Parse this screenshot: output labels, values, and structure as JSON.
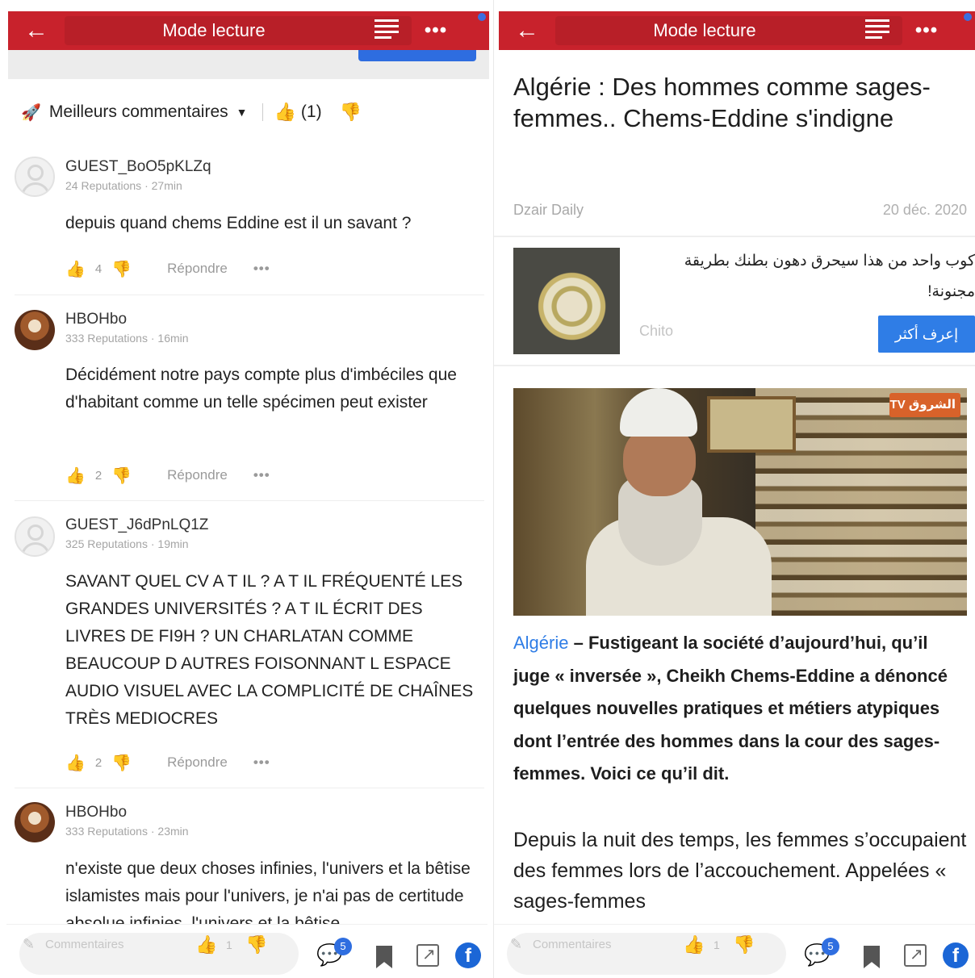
{
  "left": {
    "topbar": {
      "title": "Mode lecture",
      "back_icon": "arrow-left-icon",
      "more_label": "•••"
    },
    "sort": {
      "label": "Meilleurs commentaires",
      "like_count": "(1)"
    },
    "comments": [
      {
        "user": "GUEST_BoO5pKLZq",
        "meta": "24 Reputations · 27min",
        "text": "depuis quand chems Eddine est il un savant ?",
        "likes": "4",
        "reply": "Répondre",
        "avatar": "guest"
      },
      {
        "user": "HBOHbo",
        "meta": "333 Reputations · 16min",
        "text": "Décidément notre pays compte plus d'imbéciles que d'habitant comme un telle spécimen peut exister",
        "likes": "2",
        "reply": "Répondre",
        "avatar": "joker"
      },
      {
        "user": "GUEST_J6dPnLQ1Z",
        "meta": "325 Reputations · 19min",
        "text": "SAVANT QUEL CV A T IL ? A T IL FRÉQUENTÉ LES GRANDES UNIVERSITÉS ?  A T IL ÉCRIT DES LIVRES DE FI9H  ? UN CHARLATAN COMME BEAUCOUP D AUTRES FOISONNANT L ESPACE AUDIO VISUEL AVEC LA COMPLICITÉ DE CHAÎNES TRÈS MEDIOCRES",
        "likes": "2",
        "reply": "Répondre",
        "avatar": "guest"
      },
      {
        "user": "HBOHbo",
        "meta": "333 Reputations · 23min",
        "text": "n'existe que deux choses infinies, l'univers et la bêtise islamistes mais pour l'univers, je n'ai pas de certitude absolue infinies, l'univers et la bêtise",
        "likes": "",
        "reply": "",
        "avatar": "joker"
      }
    ],
    "bottombar": {
      "placeholder": "Commentaires",
      "like_count": "1",
      "badge": "5"
    }
  },
  "right": {
    "topbar": {
      "title": "Mode lecture",
      "back_icon": "arrow-left-icon",
      "more_label": "•••"
    },
    "article": {
      "title": "Algérie : Des hommes comme sages-femmes.. Chems-Eddine s'indigne",
      "source": "Dzair Daily",
      "date": "20 déc. 2020",
      "lead_keyword": "Algérie",
      "lead_rest": " – Fustigeant la société d’aujourd’hui, qu’il juge « inversée », Cheikh Chems-Eddine a dénoncé quelques nouvelles pratiques et métiers atypiques dont l’entrée des hommes dans la cour des sages-femmes. Voici ce qu’il dit.",
      "body": "Depuis la nuit des temps, les femmes s’occupaient des femmes lors de l’accouchement. Appelées « sages-femmes"
    },
    "ad": {
      "text": "كوب واحد من هذا سيحرق دهون بطنك بطريقة مجنونة!",
      "brand": "Chito",
      "cta": "إعرف أكثر"
    },
    "image_logo": "الشروق TV",
    "bottombar": {
      "placeholder": "Commentaires",
      "like_count": "1",
      "badge": "5"
    }
  },
  "colors": {
    "topbar": "#c8222c",
    "accent_blue": "#2f7de6",
    "facebook": "#1b66d6"
  }
}
